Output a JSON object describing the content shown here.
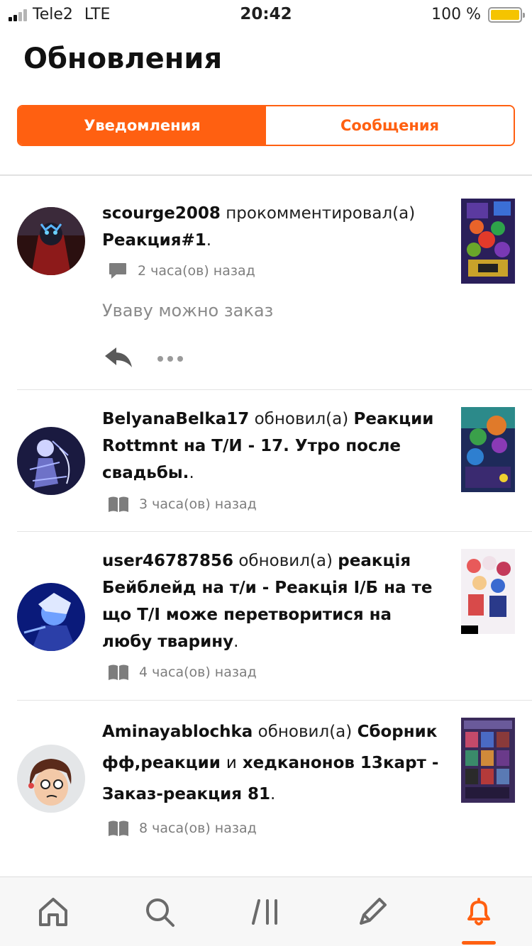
{
  "status_bar": {
    "carrier": "Tele2",
    "network": "LTE",
    "time": "20:42",
    "battery_text": "100 %",
    "battery_level": 1.0,
    "battery_color": "#f5c400"
  },
  "header": {
    "title": "Обновления"
  },
  "tabs": [
    {
      "label": "Уведомления",
      "active": true
    },
    {
      "label": "Сообщения",
      "active": false
    }
  ],
  "accent_color": "#ff6011",
  "feed": [
    {
      "user": "scourge2008",
      "action": "прокомментировал(а)",
      "target": "Реакция#1",
      "suffix": ".",
      "time": "2 часа(ов) назад",
      "meta_icon": "comment-icon",
      "comment": "Уваву можно заказ",
      "actions": [
        "reply-icon",
        "more-icon"
      ]
    },
    {
      "user": "BelyanaBelka17",
      "action": "обновил(а)",
      "target": "Реакции Rottmnt на Т/И - 17. Утро после свадьбы.",
      "suffix": ".",
      "time": "3 часа(ов) назад",
      "meta_icon": "book-icon"
    },
    {
      "user": "user46787856",
      "action": "обновил(а)",
      "target": "реакція Бейблейд на т/и - Реакція  І/Б на те що Т/І може перетворитися на любу тварину",
      "suffix": ".",
      "time": "4 часа(ов) назад",
      "meta_icon": "book-icon"
    },
    {
      "user": "Aminayablochka",
      "action": "обновил(а)",
      "target_a": "Cборник фф,реакции",
      "target_b": "и",
      "target_c": "хедканонов 13карт - Заказ-реакция 81",
      "suffix": ".",
      "time": "8 часа(ов) назад",
      "meta_icon": "book-icon"
    }
  ],
  "bottom_nav": [
    {
      "icon": "home-icon",
      "active": false
    },
    {
      "icon": "search-icon",
      "active": false
    },
    {
      "icon": "library-icon",
      "active": false
    },
    {
      "icon": "pencil-icon",
      "active": false
    },
    {
      "icon": "bell-icon",
      "active": true
    }
  ]
}
